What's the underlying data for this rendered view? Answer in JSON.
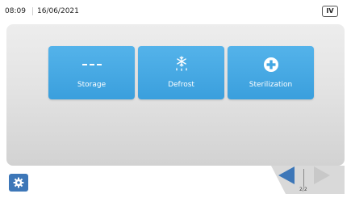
{
  "status_bar": {
    "time": "08:09",
    "date": "16/06/2021",
    "mode_badge": "IV"
  },
  "tiles": [
    {
      "label": "Storage",
      "icon": "dashes-icon"
    },
    {
      "label": "Defrost",
      "icon": "defrost-icon"
    },
    {
      "label": "Sterilization",
      "icon": "plus-circle-icon"
    }
  ],
  "settings": {
    "icon": "gear-icon"
  },
  "pager": {
    "indicator": "2/2",
    "prev_icon": "triangle-left-icon",
    "next_icon": "triangle-right-icon"
  },
  "colors": {
    "tile": "#43a7e3",
    "settings_button": "#3d77b8",
    "nav_active": "#3d77b8",
    "nav_inactive": "#c8c8c8",
    "panel": "#e3e3e3"
  }
}
